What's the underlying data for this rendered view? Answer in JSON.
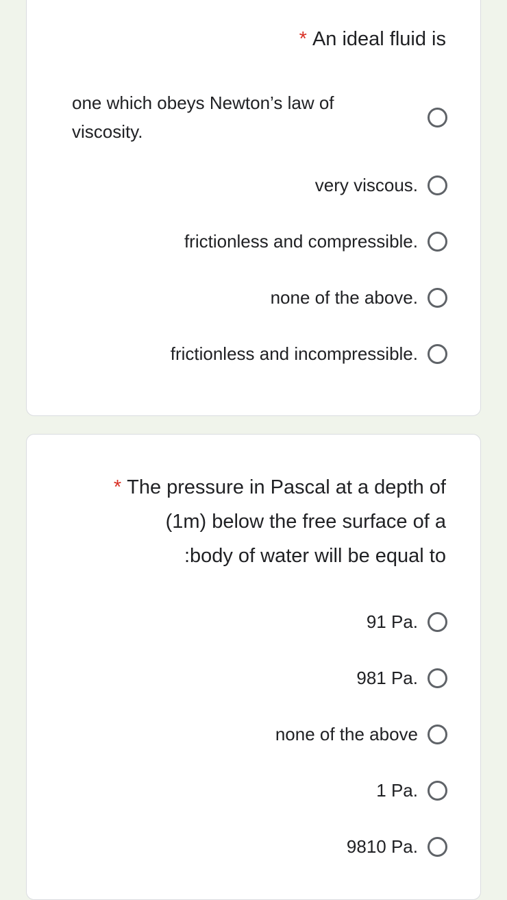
{
  "questions": [
    {
      "title": "An ideal fluid is",
      "required_mark": "*",
      "options": [
        {
          "label": "one which obeys Newton’s law of viscosity."
        },
        {
          "label": "very viscous."
        },
        {
          "label": "frictionless and compressible."
        },
        {
          "label": "none of the above."
        },
        {
          "label": "frictionless and incompressible."
        }
      ]
    },
    {
      "title_lines": [
        "The pressure in Pascal at a depth of",
        "(1m) below the free surface of a",
        ":body of water will be equal to"
      ],
      "required_mark": "*",
      "options": [
        {
          "label": "91 Pa."
        },
        {
          "label": "981 Pa."
        },
        {
          "label": "none of the above"
        },
        {
          "label": "1 Pa."
        },
        {
          "label": "9810 Pa."
        }
      ]
    }
  ],
  "colors": {
    "required": "#d93025",
    "radio_border": "#5f6368",
    "background": "#f0f4eb"
  }
}
